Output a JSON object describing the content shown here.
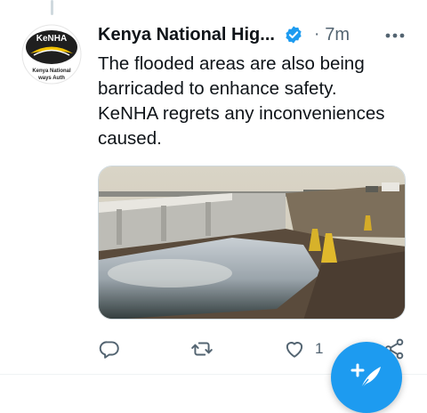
{
  "tweet": {
    "author_name": "Kenya National Hig...",
    "dot": "·",
    "time": "7m",
    "lines": [
      "The flooded areas are also being",
      "barricaded to enhance safety.",
      "KeNHA regrets any inconveniences",
      "caused."
    ],
    "avatar": {
      "logo_text": "KeNHA",
      "caption_line1": "Kenya National",
      "caption_line2": "ways Auth"
    },
    "media_icon": "photo-flooded-road-bridge"
  },
  "actions": {
    "reply_icon": "reply-icon",
    "retweet_icon": "retweet-icon",
    "like_icon": "heart-icon",
    "like_count": "1",
    "share_icon": "share-icon"
  },
  "fab": {
    "icon": "compose-feather-plus-icon"
  },
  "colors": {
    "accent": "#1d9bf0",
    "secondary_text": "#536471",
    "primary_text": "#0f1419",
    "verified": "#1d9bf0"
  }
}
